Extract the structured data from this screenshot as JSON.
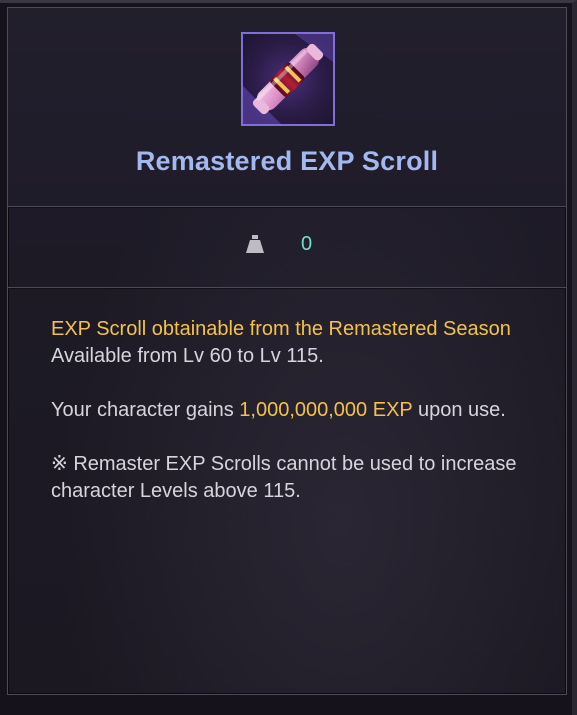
{
  "item": {
    "icon": "exp-scroll-icon",
    "title": "Remastered EXP Scroll"
  },
  "weight": {
    "icon": "weight-icon",
    "value": "0"
  },
  "description": {
    "line1_gold": "EXP Scroll obtainable from the Remastered Season",
    "line2": "Available from Lv 60 to Lv 115.",
    "line3_before": "Your character gains ",
    "line3_gold": "1,000,000,000 EXP",
    "line3_after": " upon use.",
    "line4": "※ Remaster EXP Scrolls cannot be used to increase character Levels above 115."
  },
  "colors": {
    "title": "#a2b8ee",
    "highlight": "#f3c14d",
    "weight_value": "#6fe0cf",
    "body_text": "#d7d5dc"
  }
}
